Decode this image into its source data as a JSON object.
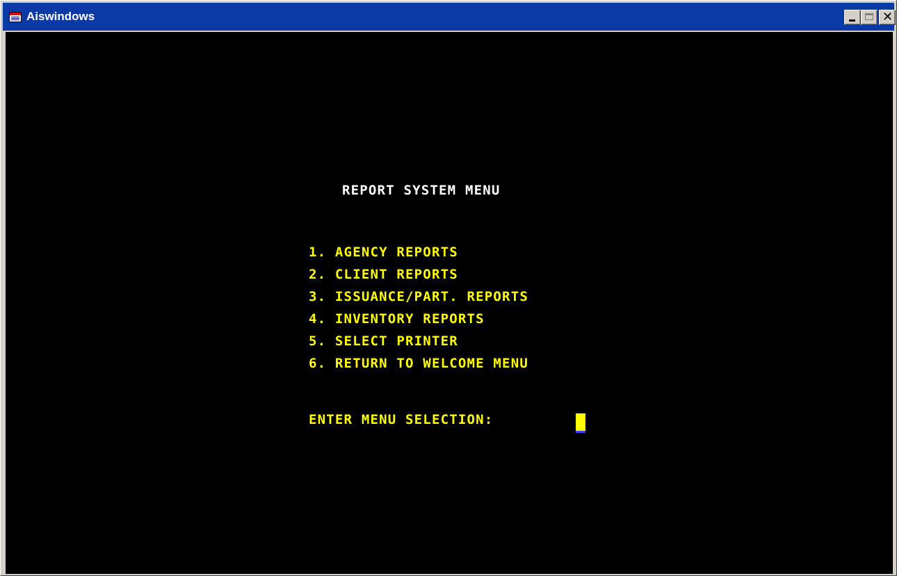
{
  "window": {
    "title": "Aiswindows",
    "controls": {
      "minimize": "minimize-icon",
      "maximize": "maximize-icon",
      "close": "close-icon"
    }
  },
  "colors": {
    "titlebar": "#0b3aa6",
    "terminal_background": "#000000",
    "title_text": "#ffffff",
    "menu_text": "#ffff00",
    "cursor": "#ffff00"
  },
  "screen": {
    "title": "REPORT SYSTEM MENU",
    "items": [
      "1. AGENCY REPORTS",
      "2. CLIENT REPORTS",
      "3. ISSUANCE/PART. REPORTS",
      "4. INVENTORY REPORTS",
      "5. SELECT PRINTER",
      "6. RETURN TO WELCOME MENU"
    ],
    "prompt": "ENTER MENU SELECTION:",
    "input_value": ""
  }
}
